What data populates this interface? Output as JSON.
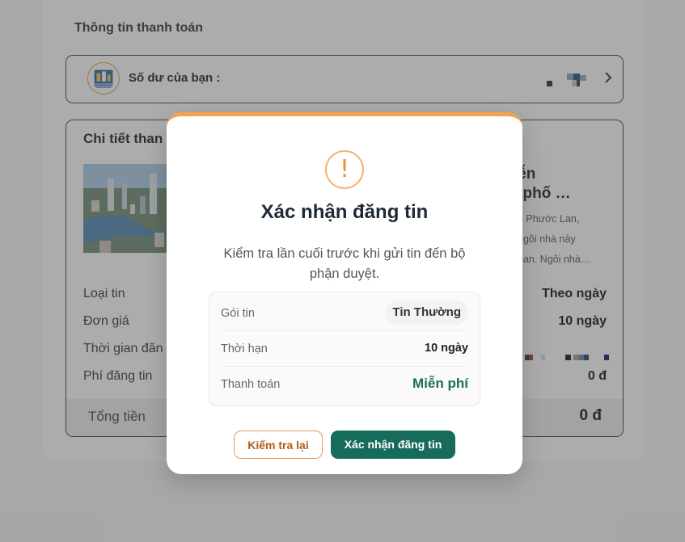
{
  "payment": {
    "section_title": "Thông tin thanh toán",
    "balance_label": "Số dư của bạn :"
  },
  "detail": {
    "title": "Chi tiết than",
    "listing_title_line1": "uyễn",
    "listing_title_line2": "nh phố …",
    "listing_desc_line1": "n Phước Lan,",
    "listing_desc_line2": "ngôi nhà này",
    "listing_desc_line3": "oan. Ngôi nhà…",
    "rows": [
      {
        "label": "Loại tin",
        "value": "Theo ngày"
      },
      {
        "label": "Đơn giá",
        "value": "10 ngày"
      },
      {
        "label": "Thời gian đăn",
        "value": ""
      },
      {
        "label": "Phí đăng tin",
        "value": "0 đ"
      }
    ],
    "total_label": "Tổng tiền",
    "total_value": "0 đ"
  },
  "modal": {
    "icon": "!",
    "title": "Xác nhận đăng tin",
    "description": "Kiểm tra lần cuối trước khi gửi tin đến bộ phận duyệt.",
    "rows": [
      {
        "label": "Gói tin",
        "value": "Tin Thường"
      },
      {
        "label": "Thời hạn",
        "value": "10 ngày"
      },
      {
        "label": "Thanh toán",
        "value": "Miễn phí"
      }
    ],
    "review_button": "Kiểm tra lại",
    "confirm_button": "Xác nhận đăng tin"
  },
  "colors": {
    "accent_orange": "#f0a24e",
    "confirm_green": "#176b5a",
    "free_text_green": "#1b6d57"
  }
}
